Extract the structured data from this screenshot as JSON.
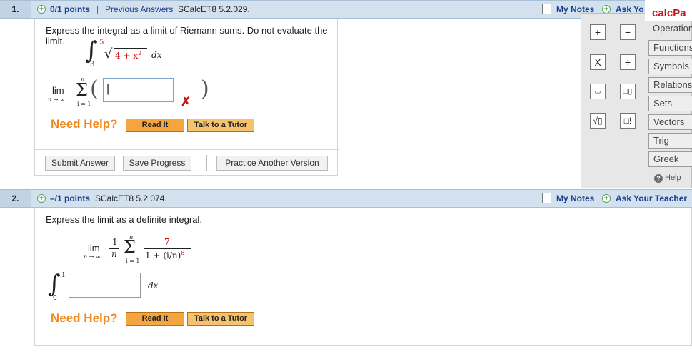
{
  "questions": [
    {
      "number": "1.",
      "points": "0/1 points",
      "separator": "|",
      "previous_answers": "Previous Answers",
      "source": "SCalcET8 5.2.029.",
      "my_notes": "My Notes",
      "ask_teacher": "Ask Yo",
      "prompt": "Express the integral as a limit of Riemann sums. Do not evaluate the limit.",
      "integral": {
        "upper": "5",
        "lower": "3",
        "integrand_prefix": "4 + x",
        "exponent": "2",
        "dx": "dx"
      },
      "limit": {
        "lim": "lim",
        "sub": "n → ∞",
        "sum_top": "n",
        "sum_bottom": "i = 1",
        "answer_value": "|"
      },
      "wrong_mark": "✗",
      "need_help": "Need Help?",
      "read_it": "Read It",
      "talk_to_tutor": "Talk to a Tutor",
      "submit_answer": "Submit Answer",
      "save_progress": "Save Progress",
      "practice_another": "Practice Another Version"
    },
    {
      "number": "2.",
      "points": "–/1 points",
      "source": "SCalcET8 5.2.074.",
      "my_notes": "My Notes",
      "ask_teacher": "Ask Your Teacher",
      "prompt": "Express the limit as a definite integral.",
      "limit": {
        "lim": "lim",
        "sub": "n → ∞",
        "frac_num": "1",
        "frac_den": "n",
        "sum_top": "n",
        "sum_bottom": "i = 1",
        "num": "7",
        "den_prefix": "1 + (i/n)",
        "den_exp": "8"
      },
      "integral": {
        "upper": "1",
        "lower": "0",
        "answer_value": "",
        "dx": "dx"
      },
      "need_help": "Need Help?",
      "read_it": "Read It",
      "talk_to_tutor": "Talk to a Tutor"
    }
  ],
  "calcpad": {
    "title": "calcPa",
    "keys": {
      "plus": "+",
      "minus": "−",
      "times": "X",
      "divide": "÷",
      "fraction": "▭",
      "power": "□▯",
      "sqrt": "√▯",
      "factorial": "□!"
    },
    "menu": [
      "Operation",
      "Functions",
      "Symbols",
      "Relations",
      "Sets",
      "Vectors",
      "Trig",
      "Greek"
    ],
    "help": "Help"
  },
  "colors": {
    "header_bar": "#d3e0ee",
    "link": "#1a3f8f",
    "need_help": "#f18a1e",
    "button_orange": "#f4a53f",
    "wrong": "#cc1111",
    "calcpad_brand": "#c8161d"
  }
}
